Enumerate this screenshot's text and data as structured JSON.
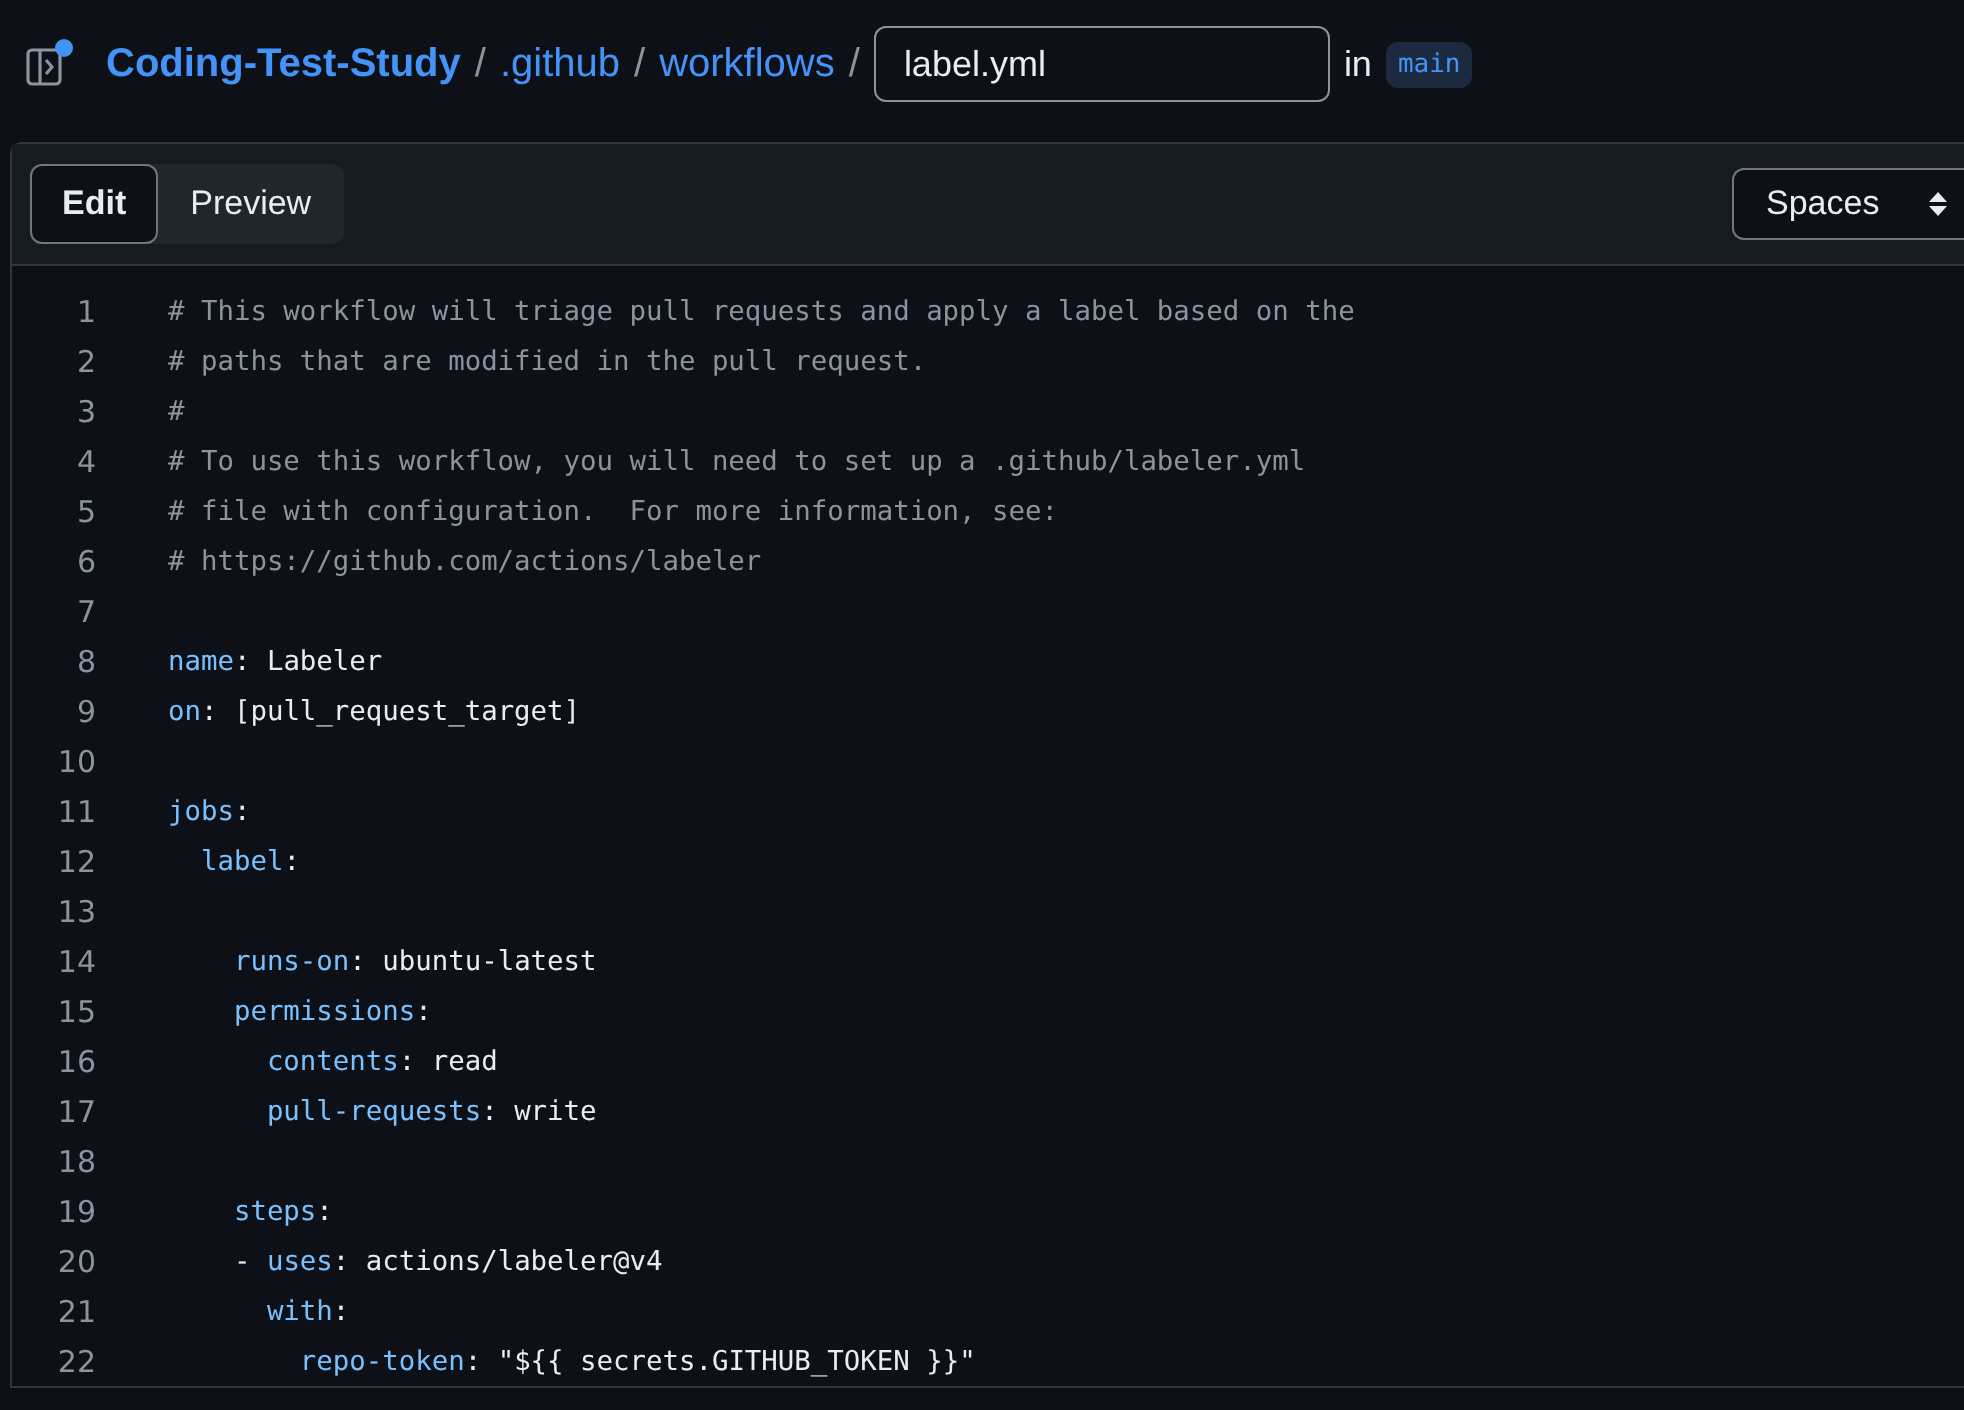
{
  "breadcrumb": {
    "repo": "Coding-Test-Study",
    "separators": [
      "/",
      "/",
      "/"
    ],
    "folders": [
      ".github",
      "workflows"
    ],
    "filename": "label.yml",
    "in_label": "in",
    "branch": "main"
  },
  "tabs": [
    {
      "label": "Edit",
      "selected": true
    },
    {
      "label": "Preview",
      "selected": false
    }
  ],
  "indent_select": {
    "value": "Spaces"
  },
  "lines": [
    {
      "number": "1",
      "kind": "comment",
      "text": "# This workflow will triage pull requests and apply a label based on the"
    },
    {
      "number": "2",
      "kind": "comment",
      "text": "# paths that are modified in the pull request."
    },
    {
      "number": "3",
      "kind": "comment",
      "text": "#"
    },
    {
      "number": "4",
      "kind": "comment",
      "text": "# To use this workflow, you will need to set up a .github/labeler.yml"
    },
    {
      "number": "5",
      "kind": "comment",
      "text": "# file with configuration.  For more information, see:"
    },
    {
      "number": "6",
      "kind": "comment",
      "text": "# https://github.com/actions/labeler"
    },
    {
      "number": "7",
      "kind": "blank"
    },
    {
      "number": "8",
      "kind": "pair",
      "key": "name",
      "colon": ":",
      "value": "Labeler"
    },
    {
      "number": "9",
      "kind": "pair",
      "key": "on",
      "colon": ":",
      "value": "[pull_request_target]"
    },
    {
      "number": "10",
      "kind": "blank"
    },
    {
      "number": "11",
      "kind": "pair",
      "key": "jobs",
      "colon": ":"
    },
    {
      "number": "12",
      "kind": "pair",
      "key": "  label",
      "colon": ":"
    },
    {
      "number": "13",
      "kind": "blank"
    },
    {
      "number": "14",
      "kind": "pair",
      "key": "    runs-on",
      "colon": ":",
      "value": "ubuntu-latest"
    },
    {
      "number": "15",
      "kind": "pair",
      "key": "    permissions",
      "colon": ":"
    },
    {
      "number": "16",
      "kind": "pair",
      "key": "      contents",
      "colon": ":",
      "value": "read"
    },
    {
      "number": "17",
      "kind": "pair",
      "key": "      pull-requests",
      "colon": ":",
      "value": "write"
    },
    {
      "number": "18",
      "kind": "blank"
    },
    {
      "number": "19",
      "kind": "pair",
      "key": "    steps",
      "colon": ":"
    },
    {
      "number": "20",
      "kind": "pair",
      "prefix": "    - ",
      "key": "uses",
      "colon": ":",
      "value": "actions/labeler@v4"
    },
    {
      "number": "21",
      "kind": "pair",
      "key": "      with",
      "colon": ":"
    },
    {
      "number": "22",
      "kind": "pair",
      "key": "        repo-token",
      "colon": ":",
      "value": "\"${{ secrets.GITHUB_TOKEN }}\""
    }
  ]
}
